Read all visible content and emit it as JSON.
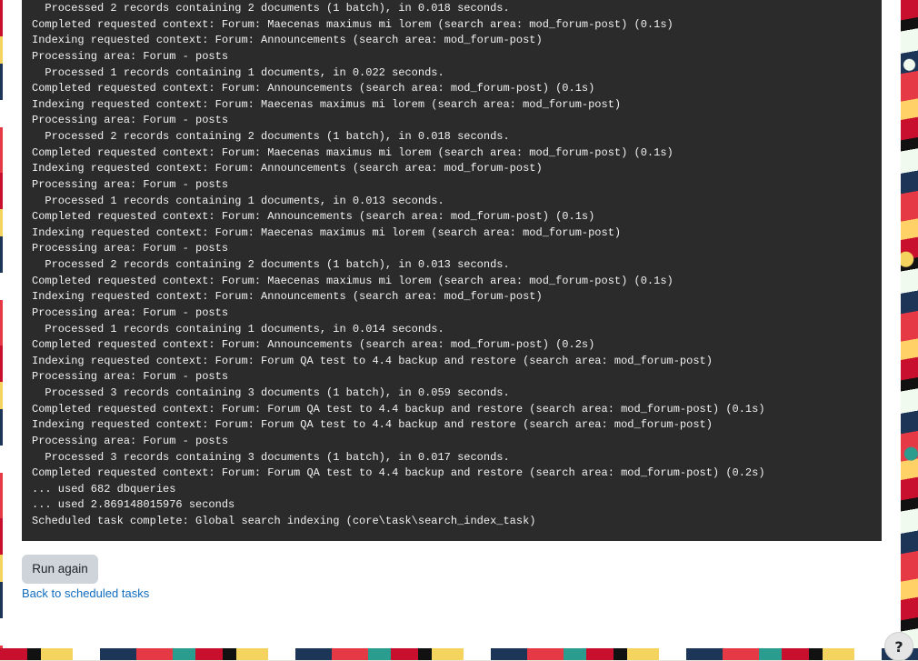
{
  "console": {
    "lines": [
      "  Processed 2 records containing 2 documents (1 batch), in 0.018 seconds.",
      "Completed requested context: Forum: Maecenas maximus mi lorem (search area: mod_forum-post) (0.1s)",
      "Indexing requested context: Forum: Announcements (search area: mod_forum-post)",
      "Processing area: Forum - posts",
      "  Processed 1 records containing 1 documents, in 0.022 seconds.",
      "Completed requested context: Forum: Announcements (search area: mod_forum-post) (0.1s)",
      "Indexing requested context: Forum: Maecenas maximus mi lorem (search area: mod_forum-post)",
      "Processing area: Forum - posts",
      "  Processed 2 records containing 2 documents (1 batch), in 0.018 seconds.",
      "Completed requested context: Forum: Maecenas maximus mi lorem (search area: mod_forum-post) (0.1s)",
      "Indexing requested context: Forum: Announcements (search area: mod_forum-post)",
      "Processing area: Forum - posts",
      "  Processed 1 records containing 1 documents, in 0.013 seconds.",
      "Completed requested context: Forum: Announcements (search area: mod_forum-post) (0.1s)",
      "Indexing requested context: Forum: Maecenas maximus mi lorem (search area: mod_forum-post)",
      "Processing area: Forum - posts",
      "  Processed 2 records containing 2 documents (1 batch), in 0.013 seconds.",
      "Completed requested context: Forum: Maecenas maximus mi lorem (search area: mod_forum-post) (0.1s)",
      "Indexing requested context: Forum: Announcements (search area: mod_forum-post)",
      "Processing area: Forum - posts",
      "  Processed 1 records containing 1 documents, in 0.014 seconds.",
      "Completed requested context: Forum: Announcements (search area: mod_forum-post) (0.2s)",
      "Indexing requested context: Forum: Forum QA test to 4.4 backup and restore (search area: mod_forum-post)",
      "Processing area: Forum - posts",
      "  Processed 3 records containing 3 documents (1 batch), in 0.059 seconds.",
      "Completed requested context: Forum: Forum QA test to 4.4 backup and restore (search area: mod_forum-post) (0.1s)",
      "Indexing requested context: Forum: Forum QA test to 4.4 backup and restore (search area: mod_forum-post)",
      "Processing area: Forum - posts",
      "  Processed 3 records containing 3 documents (1 batch), in 0.017 seconds.",
      "Completed requested context: Forum: Forum QA test to 4.4 backup and restore (search area: mod_forum-post) (0.2s)",
      "... used 682 dbqueries",
      "... used 2.869148015976 seconds",
      "Scheduled task complete: Global search indexing (core\\task\\search_index_task)"
    ]
  },
  "actions": {
    "run_again_label": "Run again",
    "back_link_label": "Back to scheduled tasks"
  },
  "help": {
    "glyph": "?",
    "icon": "question-icon"
  },
  "colors": {
    "console_bg": "#2b2b2b",
    "console_text": "#f1f1f1",
    "button_bg": "#ced4da",
    "link": "#0f6cbf"
  }
}
